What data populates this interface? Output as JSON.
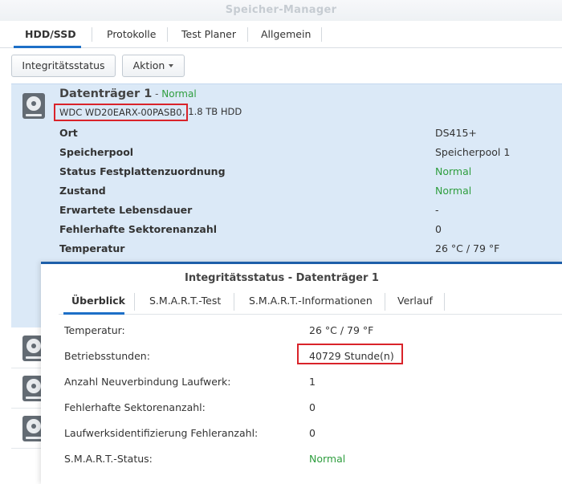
{
  "window": {
    "title": "Speicher-Manager"
  },
  "tabs": [
    {
      "label": "HDD/SSD",
      "active": true
    },
    {
      "label": "Protokolle",
      "active": false
    },
    {
      "label": "Test Planer",
      "active": false
    },
    {
      "label": "Allgemein",
      "active": false
    }
  ],
  "toolbar": {
    "health_label": "Integritätsstatus",
    "action_label": "Aktion"
  },
  "disk": {
    "name": "Datenträger 1",
    "dash": " - ",
    "status": "Normal",
    "model": "WDC WD20EARX-00PASB0",
    "capacity_type": ", 1.8 TB HDD",
    "properties": [
      {
        "label": "Ort",
        "value": "DS415+",
        "color": "#333333"
      },
      {
        "label": "Speicherpool",
        "value": "Speicherpool 1",
        "color": "#333333"
      },
      {
        "label": "Status Festplattenzuordnung",
        "value": "Normal",
        "color": "#2f9e3f"
      },
      {
        "label": "Zustand",
        "value": "Normal",
        "color": "#2f9e3f"
      },
      {
        "label": "Erwartete Lebensdauer",
        "value": "-",
        "color": "#333333"
      },
      {
        "label": "Fehlerhafte Sektorenanzahl",
        "value": "0",
        "color": "#333333"
      },
      {
        "label": "Temperatur",
        "value": "26 °C / 79 °F",
        "color": "#333333"
      }
    ]
  },
  "dialog": {
    "title": "Integritätsstatus - Datenträger 1",
    "tabs": [
      {
        "label": "Überblick",
        "active": true
      },
      {
        "label": "S.M.A.R.T.-Test",
        "active": false
      },
      {
        "label": "S.M.A.R.T.-Informationen",
        "active": false
      },
      {
        "label": "Verlauf",
        "active": false
      }
    ],
    "rows": [
      {
        "label": "Temperatur:",
        "value": "26 °C / 79 °F"
      },
      {
        "label": "Betriebsstunden:",
        "value": "40729 Stunde(n)"
      },
      {
        "label": "Anzahl Neuverbindung Laufwerk:",
        "value": "1"
      },
      {
        "label": "Fehlerhafte Sektorenanzahl:",
        "value": "0"
      },
      {
        "label": "Laufwerksidentifizierung Fehleranzahl:",
        "value": "0"
      },
      {
        "label": "S.M.A.R.T.-Status:",
        "value": "Normal"
      }
    ]
  },
  "colors": {
    "accent": "#1d6fc7",
    "selected_row": "#dbe9f7",
    "status_green": "#2f9e3f",
    "highlight_red": "#d9232a"
  },
  "icons": {
    "disk": "hdd-icon",
    "action_dropdown": "caret-down-icon"
  }
}
